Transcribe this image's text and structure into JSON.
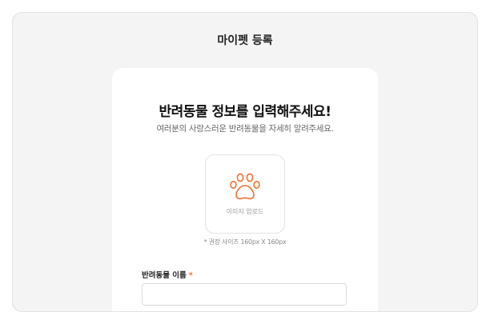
{
  "header": {
    "title": "마이펫 등록"
  },
  "form": {
    "heading": "반려동물 정보를 입력해주세요!",
    "subtitle": "여러분의 사랑스러운 반려동물을 자세히 알려주세요.",
    "upload": {
      "icon": "paw-icon",
      "label": "이미지 업로드",
      "hint": "* 권장 사이즈 160px X 160px"
    },
    "name_field": {
      "label": "반려동물 이름",
      "required_mark": "*",
      "value": "",
      "placeholder": ""
    }
  },
  "colors": {
    "accent": "#ef6f2e",
    "background": "#f4f4f4",
    "card": "#ffffff"
  }
}
